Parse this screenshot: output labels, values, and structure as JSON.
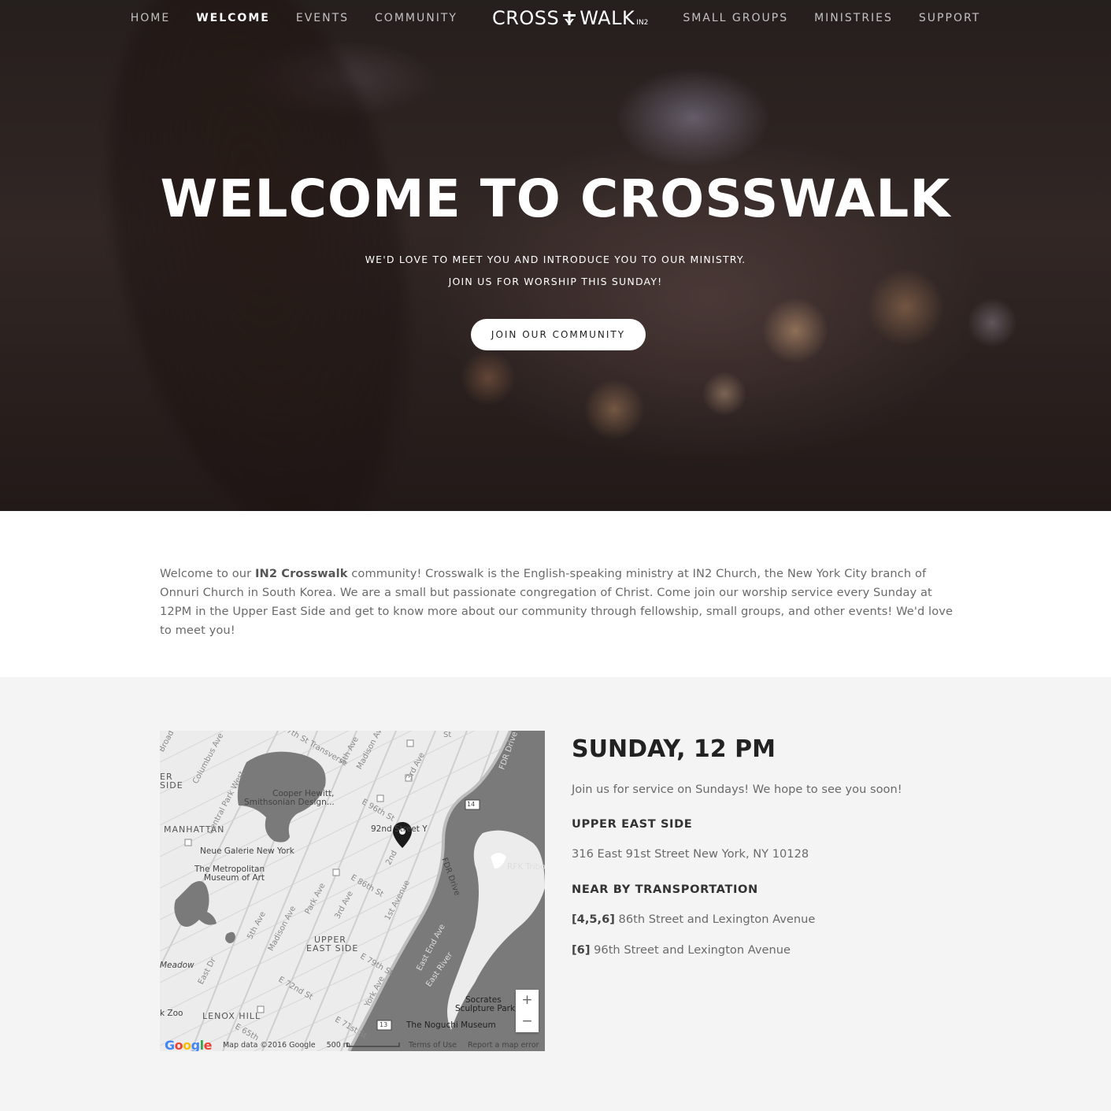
{
  "nav": {
    "left": [
      {
        "label": "HOME",
        "active": false
      },
      {
        "label": "WELCOME",
        "active": true
      },
      {
        "label": "EVENTS",
        "active": false
      },
      {
        "label": "COMMUNITY",
        "active": false
      }
    ],
    "logo": {
      "left": "CROSS",
      "right": "WALK",
      "sup": "IN2"
    },
    "right": [
      {
        "label": "SMALL GROUPS"
      },
      {
        "label": "MINISTRIES"
      },
      {
        "label": "SUPPORT"
      }
    ]
  },
  "hero": {
    "title": "WELCOME TO CROSSWALK",
    "subtitle_1": "WE'D LOVE TO MEET YOU AND INTRODUCE YOU TO OUR MINISTRY.",
    "subtitle_2": "JOIN US FOR WORSHIP THIS SUNDAY!",
    "button": "JOIN OUR COMMUNITY"
  },
  "intro": {
    "before": "Welcome to our ",
    "bold": "IN2 Crosswalk",
    "after": " community! Crosswalk is the English-speaking ministry at IN2 Church, the New York City branch of Onnuri Church in South Korea. We are a small but passionate congregation of Christ. Come join our worship service every Sunday at 12PM in the Upper East Side and get to know more about our community through fellowship, small groups, and other events! We'd love to meet you!"
  },
  "map": {
    "labels": {
      "manhattan": "MANHATTAN",
      "cooper": "Cooper Hewitt,",
      "cooper2": "Smithsonian Design...",
      "neue": "Neue Galerie New York",
      "met": "The Metropolitan",
      "met2": "Museum of Art",
      "y92": "92nd Street Y",
      "ues": "UPPER",
      "ues2": "EAST SIDE",
      "lenox": "LENOX HILL",
      "rfk": "RFK Tribo",
      "socrates": "Socrates",
      "socrates2": "Sculpture Park",
      "noguchi": "The Noguchi Museum",
      "meadow": "Meadow",
      "zoo": "k Zoo",
      "er": "ER",
      "side": "SIDE",
      "s_e96": "E 96th St",
      "s_e86": "E 86th St",
      "s_e79": "E 79th St",
      "s_e72": "E 72nd St",
      "s_e71": "E 71st St",
      "s_e65": "E 65th",
      "s_5th": "5th Ave",
      "s_5th2": "5th Ave",
      "s_madison": "Madison Av",
      "s_madison2": "Madison Ave",
      "s_park": "Park Ave",
      "s_3rd": "3rd Ave",
      "s_3rd2": "3rd Ave",
      "s_2nd": "2nd",
      "s_1st": "1st Avenue",
      "s_york": "York Ave",
      "s_fdr": "FDR Drive",
      "s_fdr2": "FDR Drive",
      "s_eastend": "East End Ave",
      "s_eastriver": "East River",
      "s_cpw": "Central Park West",
      "s_columbus": "Columbus Ave",
      "s_transverse": "97th St Transverse",
      "s_eastdr": "East Dr",
      "s_broad": "Broad",
      "s_st": "St",
      "hwy14": "14",
      "hwy13": "13"
    },
    "zoom_in": "+",
    "zoom_out": "−",
    "google": "Google",
    "footer_data": "Map data ©2016 Google",
    "footer_scale": "500 m",
    "footer_terms": "Terms of Use",
    "footer_report": "Report a map error"
  },
  "service": {
    "title": "SUNDAY, 12 PM",
    "tagline": "Join us for service on Sundays! We hope to see you soon!",
    "location_heading": "UPPER EAST SIDE",
    "address": "316 East 91st Street New York, NY 10128",
    "transport_heading": "NEAR BY TRANSPORTATION",
    "transport": [
      {
        "lines": "[4,5,6]",
        "stop": " 86th Street and Lexington Avenue"
      },
      {
        "lines": "[6]",
        "stop": " 96th Street and Lexington Avenue"
      }
    ]
  },
  "colors": {
    "hero_button_bg": "#ffffff",
    "section_bg": "#f4f4f4",
    "map_water": "#7a7a7a"
  }
}
